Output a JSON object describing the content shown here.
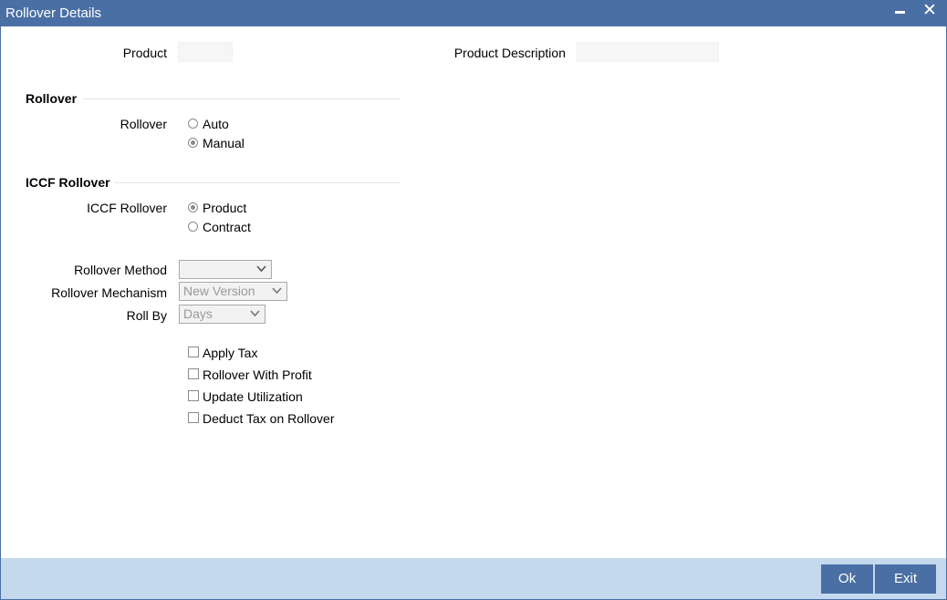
{
  "window": {
    "title": "Rollover Details",
    "close_glyph": "✕"
  },
  "header_fields": {
    "product_label": "Product",
    "product_value": "",
    "product_description_label": "Product Description",
    "product_description_value": ""
  },
  "rollover_section": {
    "title": "Rollover",
    "field_label": "Rollover",
    "options": [
      {
        "label": "Auto",
        "selected": false
      },
      {
        "label": "Manual",
        "selected": true
      }
    ]
  },
  "iccf_section": {
    "title": "ICCF Rollover",
    "field_label": "ICCF Rollover",
    "options": [
      {
        "label": "Product",
        "selected": true
      },
      {
        "label": "Contract",
        "selected": false
      }
    ]
  },
  "selects": {
    "rollover_method": {
      "label": "Rollover Method",
      "value": ""
    },
    "rollover_mechanism": {
      "label": "Rollover Mechanism",
      "value": "New Version"
    },
    "roll_by": {
      "label": "Roll By",
      "value": "Days"
    }
  },
  "checkboxes": [
    {
      "label": "Apply Tax",
      "checked": false
    },
    {
      "label": "Rollover With Profit",
      "checked": false
    },
    {
      "label": "Update Utilization",
      "checked": false
    },
    {
      "label": "Deduct Tax on Rollover",
      "checked": false
    }
  ],
  "footer": {
    "ok_label": "Ok",
    "exit_label": "Exit"
  },
  "colors": {
    "titlebar": "#4a6fa5",
    "footer": "#c4d9ee",
    "button": "#4a6fa5"
  },
  "icons": {
    "minimize": "minimize-icon",
    "close": "close-icon",
    "dropdown": "chevron-down-icon"
  }
}
